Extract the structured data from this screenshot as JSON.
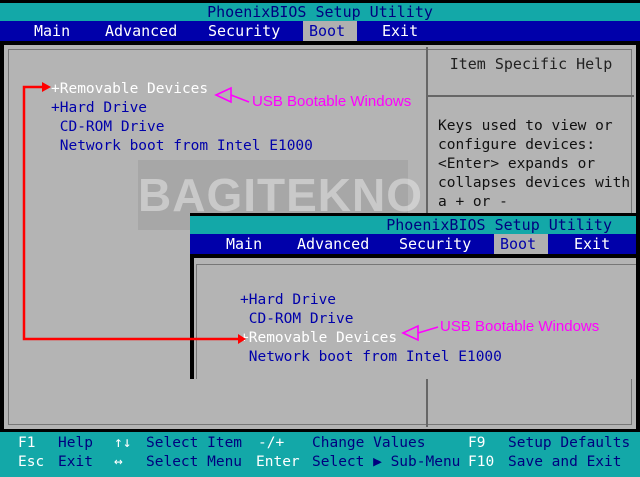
{
  "title": "PhoenixBIOS Setup Utility",
  "menu": [
    {
      "label": "Main",
      "active": false
    },
    {
      "label": "Advanced",
      "active": false
    },
    {
      "label": "Security",
      "active": false
    },
    {
      "label": "Boot",
      "active": true
    },
    {
      "label": "Exit",
      "active": false
    }
  ],
  "boot_items": [
    {
      "label": "+Removable Devices",
      "selected": true
    },
    {
      "label": "+Hard Drive",
      "selected": false
    },
    {
      "label": " CD-ROM Drive",
      "selected": false
    },
    {
      "label": " Network boot from Intel E1000",
      "selected": false
    }
  ],
  "help": {
    "title": "Item Specific Help",
    "text": "Keys used to view or\nconfigure devices:\n<Enter> expands or\ncollapses devices with\na + or -"
  },
  "annotation": "USB Bootable Windows",
  "watermark": "BAGITEKNO",
  "inset": {
    "title": "PhoenixBIOS Setup Utility",
    "menu": [
      "Main",
      "Advanced",
      "Security",
      "Boot",
      "Exit"
    ],
    "boot_items": [
      {
        "label": "+Hard Drive",
        "selected": false
      },
      {
        "label": " CD-ROM Drive",
        "selected": false
      },
      {
        "label": "+Removable Devices",
        "selected": true
      },
      {
        "label": " Network boot from Intel E1000",
        "selected": false
      }
    ],
    "annotation": "USB Bootable Windows"
  },
  "status": {
    "row1": {
      "k1": "F1",
      "d1": "Help",
      "k2": "↑↓",
      "d2": "Select Item",
      "k3": "-/+",
      "d3": "Change Values",
      "k4": "F9",
      "d4": "Setup Defaults"
    },
    "row2": {
      "k1": "Esc",
      "d1": "Exit",
      "k2": "↔",
      "d2": "Select Menu",
      "k3": "Enter",
      "d3": "Select ▶ Sub-Menu",
      "k4": "F10",
      "d4": "Save and Exit"
    }
  },
  "colors": {
    "bios_blue": "#0000aa",
    "bios_cyan": "#13a8a8",
    "bios_gray": "#b4b4b4",
    "annotation": "#ff00ff",
    "arrow": "#ff0000"
  }
}
